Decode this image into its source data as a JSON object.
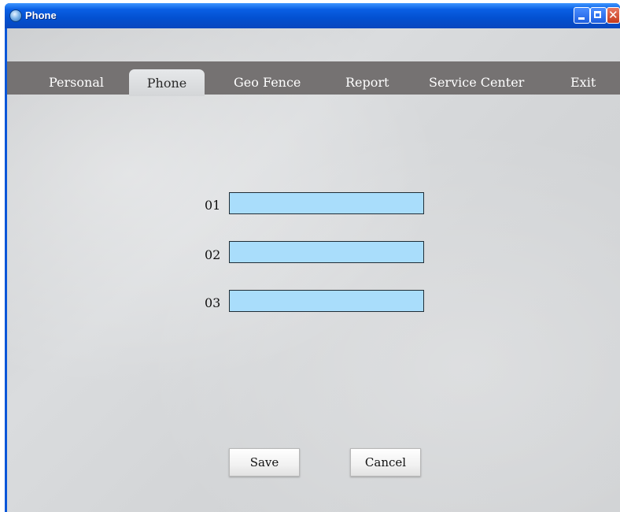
{
  "window": {
    "title": "Phone",
    "controls": {
      "minimize_icon": "minimize-icon",
      "maximize_icon": "maximize-icon",
      "close_icon": "close-icon",
      "close_glyph": "✕"
    }
  },
  "tabs": [
    {
      "label": "Personal",
      "active": false
    },
    {
      "label": "Phone",
      "active": true
    },
    {
      "label": "Geo Fence",
      "active": false
    },
    {
      "label": "Report",
      "active": false
    },
    {
      "label": "Service Center",
      "active": false
    },
    {
      "label": "Exit",
      "active": false
    }
  ],
  "fields": [
    {
      "label": "01",
      "value": ""
    },
    {
      "label": "02",
      "value": ""
    },
    {
      "label": "03",
      "value": ""
    }
  ],
  "buttons": {
    "save_label": "Save",
    "cancel_label": "Cancel"
  },
  "colors": {
    "tab_bar": "#757272",
    "input_fill": "#a9ddfb",
    "title_bar": "#0a5fe4"
  }
}
